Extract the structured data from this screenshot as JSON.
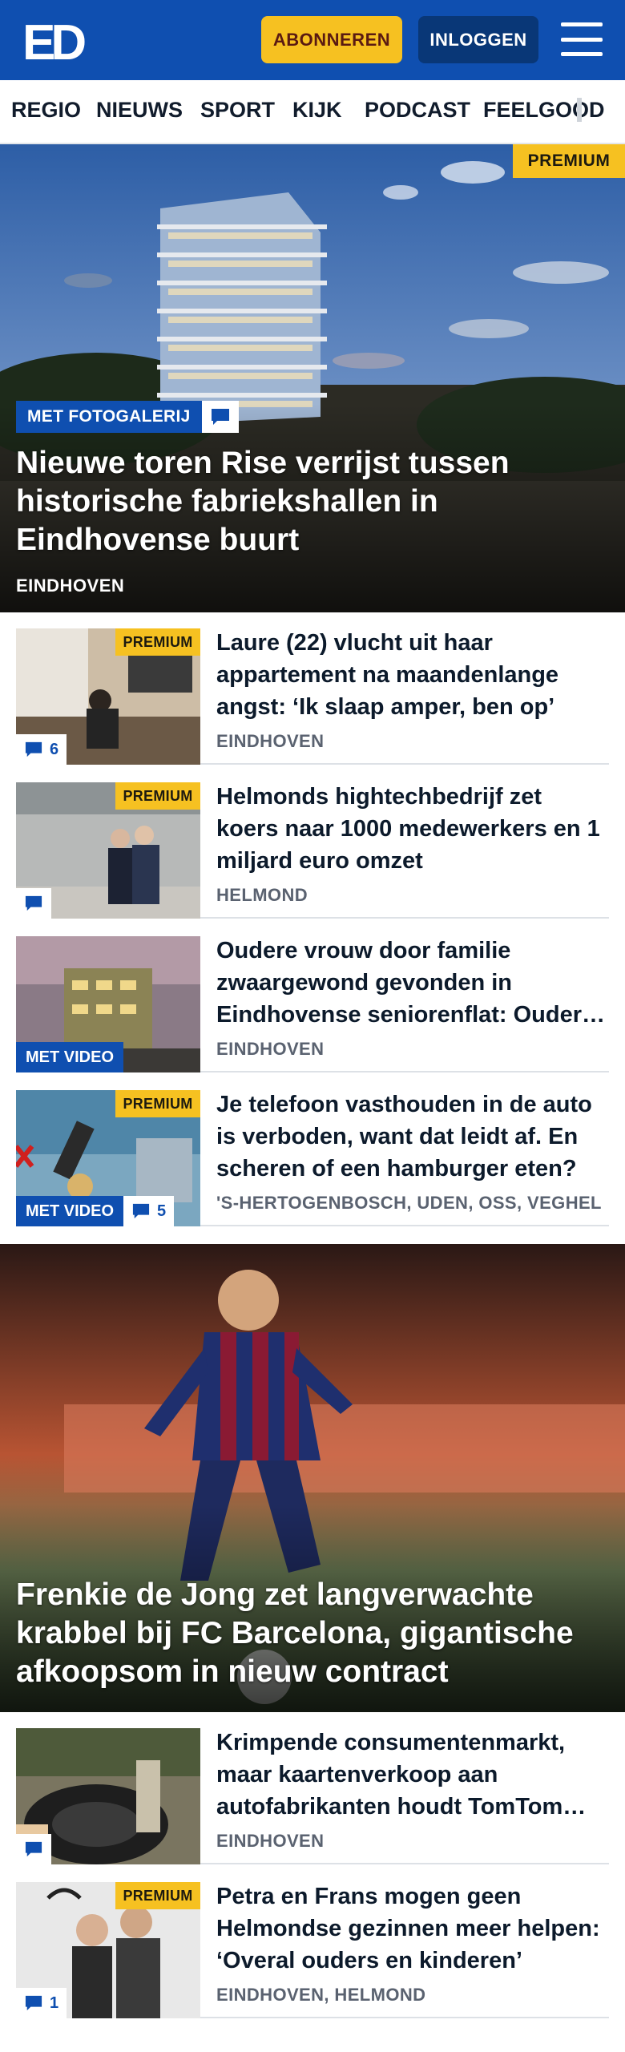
{
  "header": {
    "logo_text": "ED",
    "subscribe_label": "ABONNEREN",
    "login_label": "INLOGGEN",
    "menu_icon": "hamburger-menu-icon"
  },
  "nav": {
    "items": [
      {
        "label": "REGIO"
      },
      {
        "label": "NIEUWS"
      },
      {
        "label": "SPORT"
      },
      {
        "label": "KIJK"
      },
      {
        "label": "PODCAST"
      },
      {
        "label": "FEELGOOD"
      }
    ]
  },
  "hero1": {
    "premium_label": "PREMIUM",
    "tag_label": "MET FOTOGALERIJ",
    "comment_icon": "comment-icon",
    "title": "Nieuwe toren Rise verrijst tussen historische fabriekshallen in Eindhovense buurt",
    "location": "EINDHOVEN"
  },
  "list1": [
    {
      "title": "Laure (22) vlucht uit haar appartement na maandenlange angst: ‘Ik slaap amper, ben op’",
      "location": "EINDHOVEN",
      "premium": "PREMIUM",
      "comments": "6"
    },
    {
      "title": "Helmonds hightechbedrijf zet koers naar 1000 medewerkers en 1 miljard euro omzet",
      "location": "HELMOND",
      "premium": "PREMIUM",
      "comments": ""
    },
    {
      "title": "Oudere vrouw door familie zwaargewond gevonden in Eindhovense seniorenflat: Oudere vrouw",
      "location": "EINDHOVEN",
      "video": "MET VIDEO"
    },
    {
      "title": "Je telefoon vasthouden in de auto is verboden, want dat leidt af. En scheren of een hamburger eten?",
      "location": "'S-HERTOGENBOSCH, UDEN, OSS, VEGHEL",
      "premium": "PREMIUM",
      "video": "MET VIDEO",
      "comments": "5"
    }
  ],
  "hero2": {
    "title": "Frenkie de Jong zet langverwachte krabbel bij FC Barcelona, gigantische afkoopsom in nieuw contract"
  },
  "list2": [
    {
      "title": "Krimpende consumentenmarkt, maar kaartenverkoop aan autofabrikanten houdt TomTom overeind",
      "location": "EINDHOVEN",
      "comments": ""
    },
    {
      "title": "Petra en Frans mogen geen Helmondse gezinnen meer helpen: ‘Overal ouders en kinderen’",
      "location": "EINDHOVEN, HELMOND",
      "premium": "PREMIUM",
      "comments": "1"
    }
  ],
  "colors": {
    "brand_blue": "#0f4fb0",
    "premium_yellow": "#f6c121",
    "dark_blue": "#093777"
  }
}
